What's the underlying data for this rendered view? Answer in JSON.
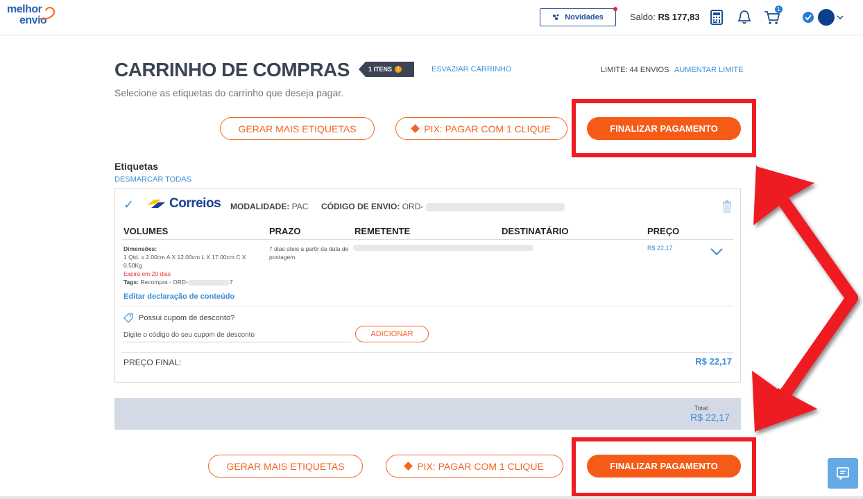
{
  "topbar": {
    "logo_line1": "melhor",
    "logo_line2": "envio",
    "novidades_label": "Novidades",
    "saldo_label": "Saldo:",
    "saldo_value": "R$ 177,83",
    "cart_badge": "1",
    "icons": [
      "calculator-icon",
      "bell-icon",
      "cart-icon",
      "verified-icon",
      "avatar",
      "chevron-down-icon"
    ]
  },
  "header": {
    "title": "CARRINHO DE COMPRAS",
    "items_badge": "1 ITENS",
    "items_badge_dot": "!",
    "esvaziar": "ESVAZIAR CARRINHO",
    "limite": "LIMITE: 44 ENVIOS",
    "aumentar": "AUMENTAR LIMITE",
    "subtitle": "Selecione as etiquetas do carrinho que deseja pagar."
  },
  "actions_top": {
    "gerar": "GERAR MAIS ETIQUETAS",
    "pix": "PIX: PAGAR COM 1 CLIQUE",
    "finalizar": "FINALIZAR PAGAMENTO"
  },
  "etiquetas": {
    "title": "Etiquetas",
    "desmarcar": "DESMARCAR TODAS",
    "card": {
      "carrier": "Correios",
      "modalidade_label": "MODALIDADE:",
      "modalidade_value": "PAC",
      "codigo_label": "CÓDIGO DE ENVIO:",
      "codigo_value": "ORD-",
      "columns": [
        "VOLUMES",
        "PRAZO",
        "REMETENTE",
        "DESTINATÁRIO",
        "PREÇO"
      ],
      "dims_label": "Dimensões:",
      "dims_line1": "1 Qtd. x 2.00cm A X 12.00cm L X 17.00cm C X",
      "dims_line2": "0.50Kg",
      "expira": "Expira em 20 dias",
      "tags_label": "Tags:",
      "tags_value": "Recompra - ORD-",
      "tags_suffix": "7",
      "prazo": "7 dias úteis a partir da data de postagem",
      "preco": "R$ 22,17",
      "editar": "Editar declaração de conteúdo",
      "cupom_question": "Possui cupom de desconto?",
      "cupom_placeholder": "Digite o código do seu cupom de desconto",
      "adicionar": "ADICIONAR",
      "preco_final_label": "PREÇO FINAL:",
      "preco_final_value": "R$ 22,17"
    }
  },
  "total": {
    "label": "Total",
    "value": "R$ 22,17"
  },
  "actions_bottom": {
    "gerar": "GERAR MAIS ETIQUETAS",
    "pix": "PIX: PAGAR COM 1 CLIQUE",
    "finalizar": "FINALIZAR PAGAMENTO"
  },
  "colors": {
    "brand_blue": "#2a63b4",
    "link_blue": "#3c8fd6",
    "orange": "#f55b17",
    "annotation_red": "#ee1c24",
    "title_dark": "#3b4454"
  }
}
